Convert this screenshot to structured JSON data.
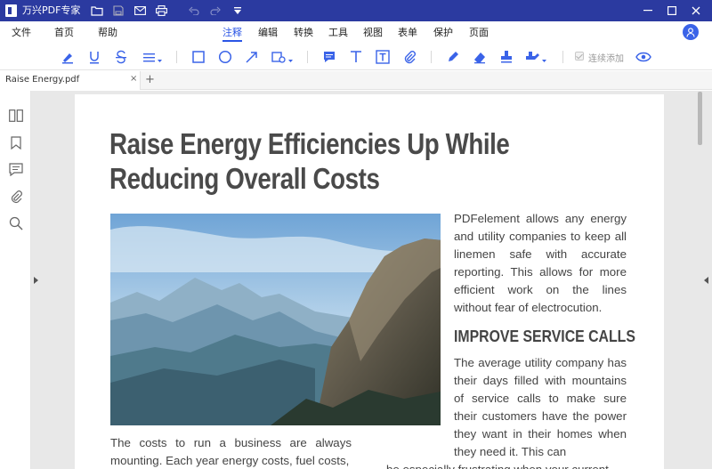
{
  "app": {
    "title": "万兴PDF专家"
  },
  "menu": {
    "file": "文件",
    "home": "首页",
    "help": "帮助",
    "tabs": [
      "注释",
      "编辑",
      "转换",
      "工具",
      "视图",
      "表单",
      "保护",
      "页面"
    ],
    "active_tab": "注释"
  },
  "toolbar": {
    "continuous_add": "连续添加"
  },
  "document_tab": {
    "name": "Raise Energy.pdf",
    "close": "×",
    "add": "+"
  },
  "document": {
    "heading_line1": "Raise Energy Efficiencies Up While",
    "heading_line2": "Reducing Overall Costs",
    "right_paragraph": "PDFelement allows any energy and utility companies to keep all linemen safe with accurate reporting. This allows for more efficient work on the lines without fear of electrocution.",
    "subheading": "IMPROVE SERVICE CALLS",
    "right_paragraph2": "The average utility company has their days filled with mountains of service calls to make sure their customers have the power they want in their homes when they need it. This can",
    "right_paragraph2_cut": "be especially frustrating when your current",
    "left_paragraph": "The costs to run a business are always mounting. Each year energy costs, fuel costs,"
  },
  "colors": {
    "titlebar": "#2b3aa0",
    "accent": "#2a55e5",
    "icon": "#3a63e8"
  }
}
